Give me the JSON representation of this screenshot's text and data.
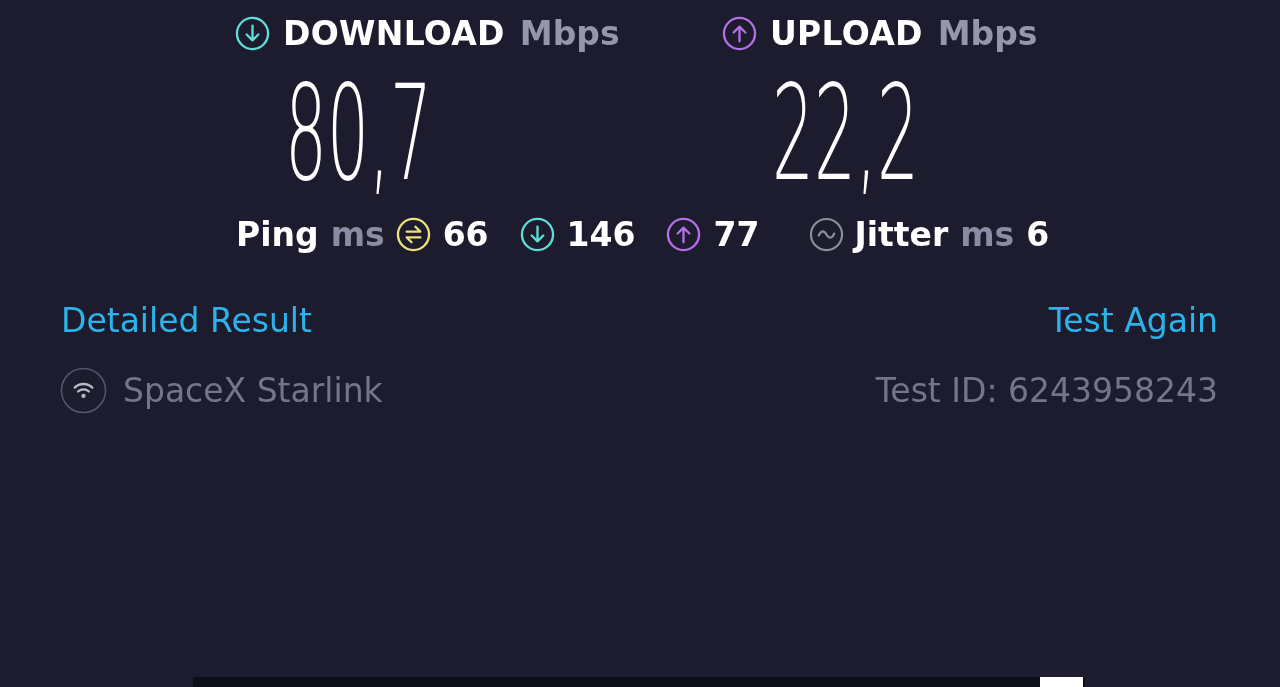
{
  "results": [
    {
      "kind": "download",
      "label": "DOWNLOAD",
      "unit": "Mbps",
      "value": "80,7",
      "color": "#5fdcd6"
    },
    {
      "kind": "upload",
      "label": "UPLOAD",
      "unit": "Mbps",
      "value": "22,2",
      "color": "#b56fe6"
    }
  ],
  "latency": {
    "label": "Ping",
    "unit": "ms",
    "readings": [
      {
        "kind": "idle",
        "value": "66",
        "color": "#eee07a"
      },
      {
        "kind": "download",
        "value": "146",
        "color": "#5fdcd6"
      },
      {
        "kind": "upload",
        "value": "77",
        "color": "#b56fe6"
      }
    ]
  },
  "jitter": {
    "label": "Jitter",
    "unit": "ms",
    "value": "6"
  },
  "links": [
    "Detailed Result",
    "Test Again"
  ],
  "provider": "SpaceX Starlink",
  "test_id": "Test ID: 6243958243"
}
